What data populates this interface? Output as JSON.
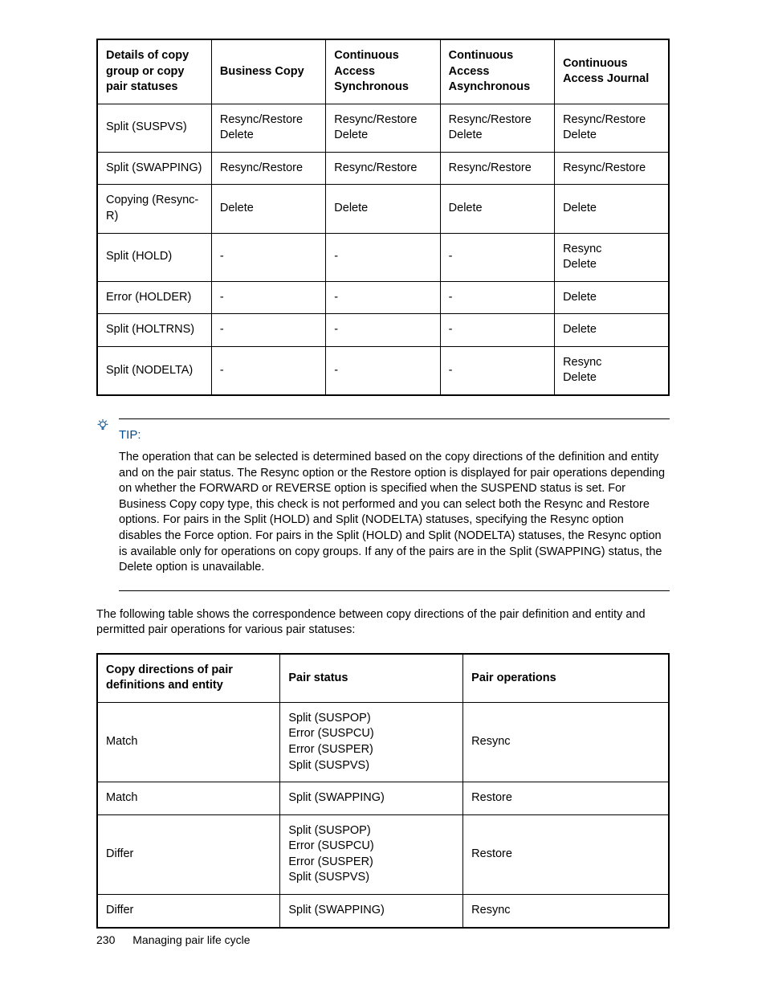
{
  "table1": {
    "headers": [
      "Details of copy group or copy pair statuses",
      "Business Copy",
      "Continuous Access Synchronous",
      "Continuous Access Asynchronous",
      "Continuous Access Journal"
    ],
    "rows": [
      {
        "c0": "Split (SUSPVS)",
        "c1a": "Resync/Restore",
        "c1b": "Delete",
        "c2a": "Resync/Restore",
        "c2b": "Delete",
        "c3a": "Resync/Restore",
        "c3b": "Delete",
        "c4a": "Resync/Restore",
        "c4b": "Delete"
      },
      {
        "c0": "Split (SWAPPING)",
        "c1a": "Resync/Restore",
        "c1b": "",
        "c2a": "Resync/Restore",
        "c2b": "",
        "c3a": "Resync/Restore",
        "c3b": "",
        "c4a": "Resync/Restore",
        "c4b": ""
      },
      {
        "c0": "Copying (Resync-R)",
        "c1a": "Delete",
        "c1b": "",
        "c2a": "Delete",
        "c2b": "",
        "c3a": "Delete",
        "c3b": "",
        "c4a": "Delete",
        "c4b": ""
      },
      {
        "c0": "Split (HOLD)",
        "c1a": "-",
        "c1b": "",
        "c2a": "-",
        "c2b": "",
        "c3a": "-",
        "c3b": "",
        "c4a": "Resync",
        "c4b": "Delete"
      },
      {
        "c0": "Error (HOLDER)",
        "c1a": "-",
        "c1b": "",
        "c2a": "-",
        "c2b": "",
        "c3a": "-",
        "c3b": "",
        "c4a": "Delete",
        "c4b": ""
      },
      {
        "c0": "Split (HOLTRNS)",
        "c1a": "-",
        "c1b": "",
        "c2a": "-",
        "c2b": "",
        "c3a": "-",
        "c3b": "",
        "c4a": "Delete",
        "c4b": ""
      },
      {
        "c0": "Split (NODELTA)",
        "c1a": "-",
        "c1b": "",
        "c2a": "-",
        "c2b": "",
        "c3a": "-",
        "c3b": "",
        "c4a": "Resync",
        "c4b": "Delete"
      }
    ]
  },
  "tip": {
    "label": "TIP:",
    "body": "The operation that can be selected is determined based on the copy directions of the definition and entity and on the pair status. The Resync option or the Restore option is displayed for pair operations depending on whether the FORWARD or REVERSE option is specified when the SUSPEND status is set. For Business Copy copy type, this check is not performed and you can select both the Resync and Restore options. For pairs in the Split (HOLD) and Split (NODELTA) statuses, specifying the Resync option disables the Force option. For pairs in the Split (HOLD) and Split (NODELTA) statuses, the Resync option is available only for operations on copy groups. If any of the pairs are in the Split (SWAPPING) status, the Delete option is unavailable."
  },
  "para": "The following table shows the correspondence between copy directions of the pair definition and entity and permitted pair operations for various pair statuses:",
  "table2": {
    "headers": [
      "Copy directions of pair definitions and entity",
      "Pair status",
      "Pair operations"
    ],
    "rows": [
      {
        "c0": "Match",
        "c1_lines": [
          "Split (SUSPOP)",
          "Error (SUSPCU)",
          "Error (SUSPER)",
          "Split (SUSPVS)"
        ],
        "c2": "Resync"
      },
      {
        "c0": "Match",
        "c1_lines": [
          "Split (SWAPPING)"
        ],
        "c2": "Restore"
      },
      {
        "c0": "Differ",
        "c1_lines": [
          "Split (SUSPOP)",
          "Error (SUSPCU)",
          "Error (SUSPER)",
          "Split (SUSPVS)"
        ],
        "c2": "Restore"
      },
      {
        "c0": "Differ",
        "c1_lines": [
          "Split (SWAPPING)"
        ],
        "c2": "Resync"
      }
    ]
  },
  "footer": {
    "page": "230",
    "title": "Managing pair life cycle"
  }
}
